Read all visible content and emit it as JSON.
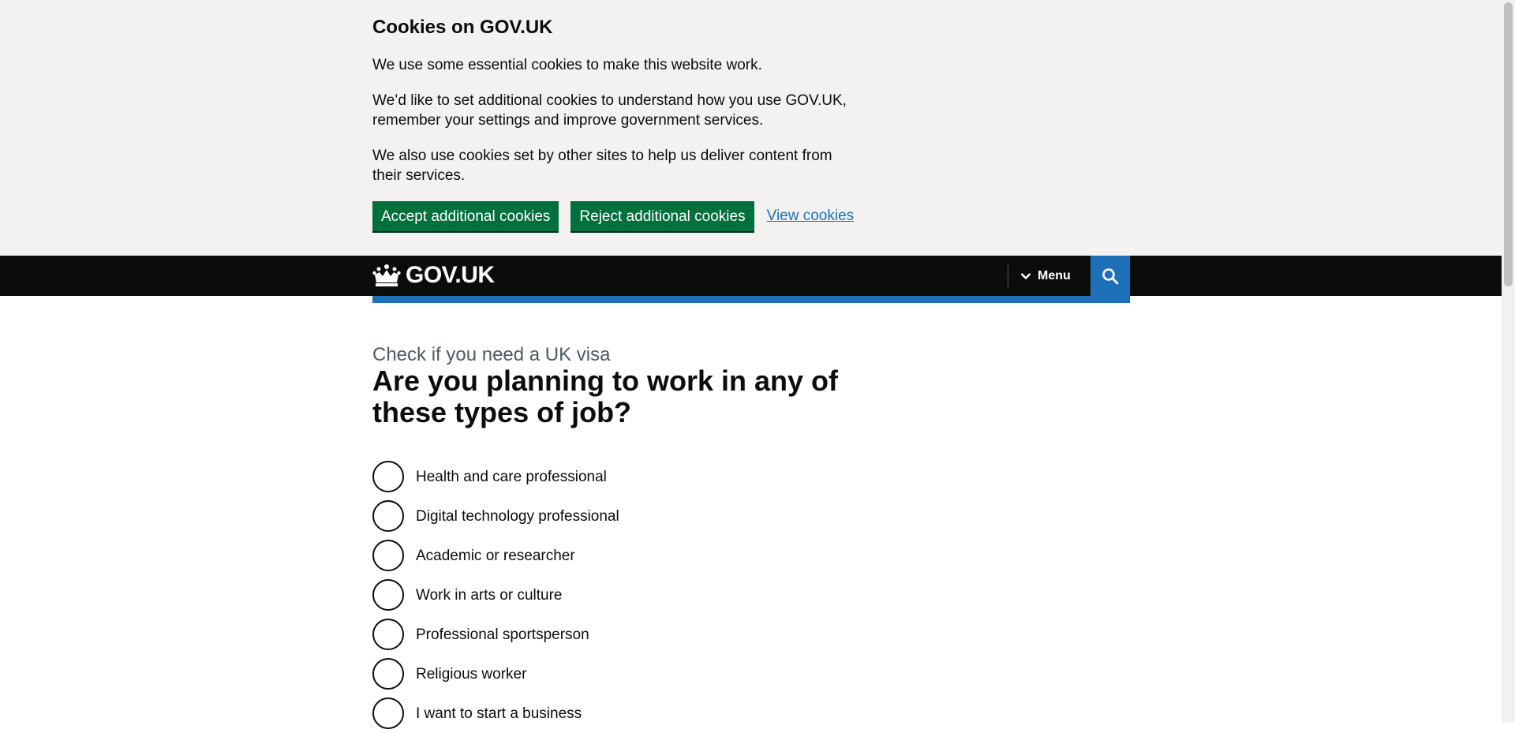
{
  "cookie_banner": {
    "heading": "Cookies on GOV.UK",
    "paragraphs": [
      "We use some essential cookies to make this website work.",
      "We’d like to set additional cookies to understand how you use GOV.UK, remember your settings and improve government services.",
      "We also use cookies set by other sites to help us deliver content from their services."
    ],
    "accept_label": "Accept additional cookies",
    "reject_label": "Reject additional cookies",
    "view_label": "View cookies"
  },
  "header": {
    "logo_text": "GOV.UK",
    "logo_icon": "crown-icon",
    "menu_label": "Menu",
    "menu_icon": "chevron-down-icon",
    "search_icon": "search-icon"
  },
  "main": {
    "caption": "Check if you need a UK visa",
    "question": "Are you planning to work in any of these types of job?",
    "options": [
      "Health and care professional",
      "Digital technology professional",
      "Academic or researcher",
      "Work in arts or culture",
      "Professional sportsperson",
      "Religious worker",
      "I want to start a business"
    ]
  },
  "colors": {
    "banner_bg": "#f3f2f1",
    "button_green": "#00703c",
    "link_blue": "#1d70b8",
    "header_black": "#0b0c0c",
    "caption_grey": "#505a5f"
  }
}
